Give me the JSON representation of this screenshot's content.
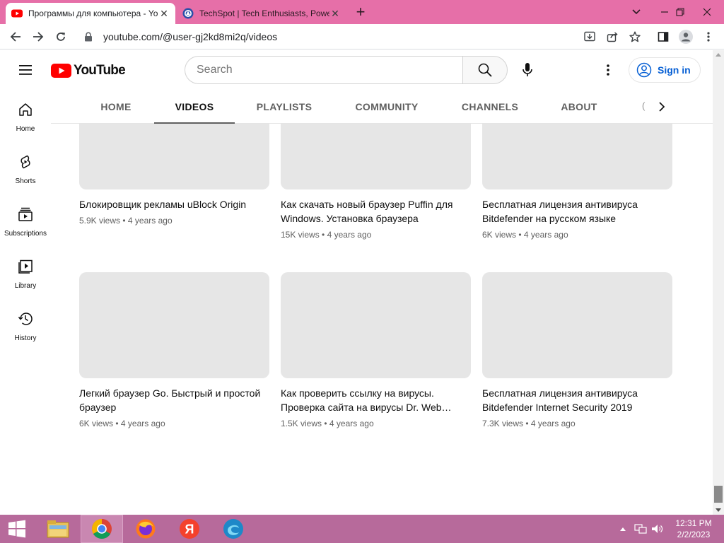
{
  "browser": {
    "tabs": [
      {
        "title": "Программы для компьютера - YouTube",
        "favicon": "youtube-favicon",
        "active": true
      },
      {
        "title": "TechSpot | Tech Enthusiasts, Power Users",
        "favicon": "techspot-favicon",
        "active": false
      }
    ],
    "url": "youtube.com/@user-gj2kd8mi2q/videos",
    "accent_color": "#e66fa8"
  },
  "youtube": {
    "logo_text": "YouTube",
    "search_placeholder": "Search",
    "sign_in_label": "Sign in",
    "guide": [
      {
        "label": "Home",
        "icon": "home-icon"
      },
      {
        "label": "Shorts",
        "icon": "shorts-icon"
      },
      {
        "label": "Subscriptions",
        "icon": "subscriptions-icon"
      },
      {
        "label": "Library",
        "icon": "library-icon"
      },
      {
        "label": "History",
        "icon": "history-icon"
      }
    ],
    "channel_tabs": [
      {
        "label": "HOME",
        "selected": false
      },
      {
        "label": "VIDEOS",
        "selected": true
      },
      {
        "label": "PLAYLISTS",
        "selected": false
      },
      {
        "label": "COMMUNITY",
        "selected": false
      },
      {
        "label": "CHANNELS",
        "selected": false
      },
      {
        "label": "ABOUT",
        "selected": false
      }
    ],
    "partial_tab_glyph": "(",
    "videos": [
      {
        "title": "Блокировщик рекламы uBlock Origin",
        "views": "5.9K views",
        "age": "4 years ago"
      },
      {
        "title": "Как скачать новый браузер Puffin для Windows. Установка браузера",
        "views": "15K views",
        "age": "4 years ago"
      },
      {
        "title": "Бесплатная лицензия антивируса Bitdefender на русском языке",
        "views": "6K views",
        "age": "4 years ago"
      },
      {
        "title": "Легкий браузер Go. Быстрый и простой браузер",
        "views": "6K views",
        "age": "4 years ago"
      },
      {
        "title": "Как проверить ссылку на вирусы. Проверка сайта на вирусы Dr. Web…",
        "views": "1.5K views",
        "age": "4 years ago"
      },
      {
        "title": "Бесплатная лицензия антивируса Bitdefender Internet Security 2019",
        "views": "7.3K views",
        "age": "4 years ago"
      }
    ],
    "meta_separator": "•"
  },
  "taskbar": {
    "apps": [
      "file-explorer-icon",
      "chrome-icon",
      "firefox-icon",
      "yandex-icon",
      "edge-icon"
    ],
    "active_app": "chrome-icon",
    "yandex_letter": "Я",
    "time": "12:31 PM",
    "date": "2/2/2023",
    "color": "#b76a9b"
  }
}
